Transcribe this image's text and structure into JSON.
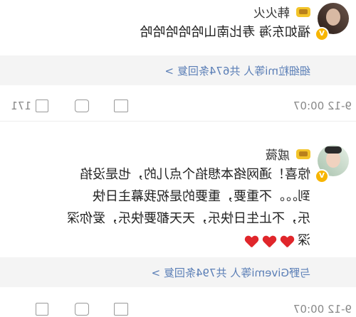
{
  "comments": [
    {
      "name": "韩火火",
      "text": "福如东海 寿比南山哈哈哈哈哈",
      "reply_summary": "细细粒mi等人 共674条回复 >",
      "timestamp": "9-12 00:07",
      "like_count": "171",
      "avatar_color": "#4a3b35"
    },
    {
      "name": "戚薇",
      "text_lines": [
        "惊喜！通网络本想掐个点儿的，也是没掐",
        "到。。。不重要，重要的是祝我幕主日快",
        "乐，不止生日快乐，天天都要快乐，爱你深",
        "深"
      ],
      "reply_summary": "与野Givemi等人 共794条回复 >",
      "timestamp": "9-12 00:07",
      "avatar_color": "#c4d6c6"
    }
  ],
  "colors": {
    "accent": "#f7b500",
    "link": "#5a7eb6",
    "heart": "#e0262b"
  },
  "icons": [
    "crown-icon",
    "verified-badge-icon",
    "comment-icon",
    "repost-icon",
    "like-icon",
    "heart-icon"
  ]
}
